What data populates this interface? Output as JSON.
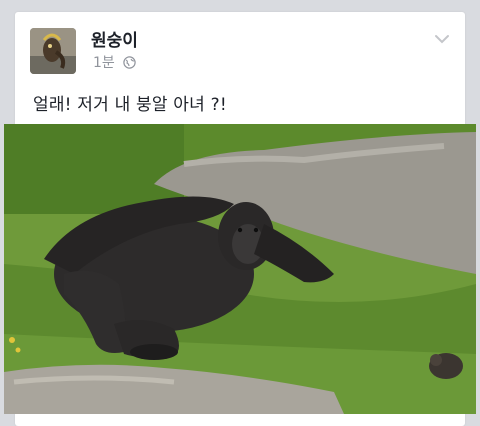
{
  "post": {
    "author_name": "원숭이",
    "timestamp": "1분",
    "privacy_icon": "globe-icon",
    "menu_icon": "chevron-down-icon",
    "text": "얼래! 저거 내 붕알 아녀 ?!"
  },
  "photo": {
    "subject": "gorilla-photo"
  },
  "colors": {
    "background": "#d9dbe0",
    "card": "#ffffff",
    "text": "#1d2129",
    "muted": "#90949c"
  }
}
